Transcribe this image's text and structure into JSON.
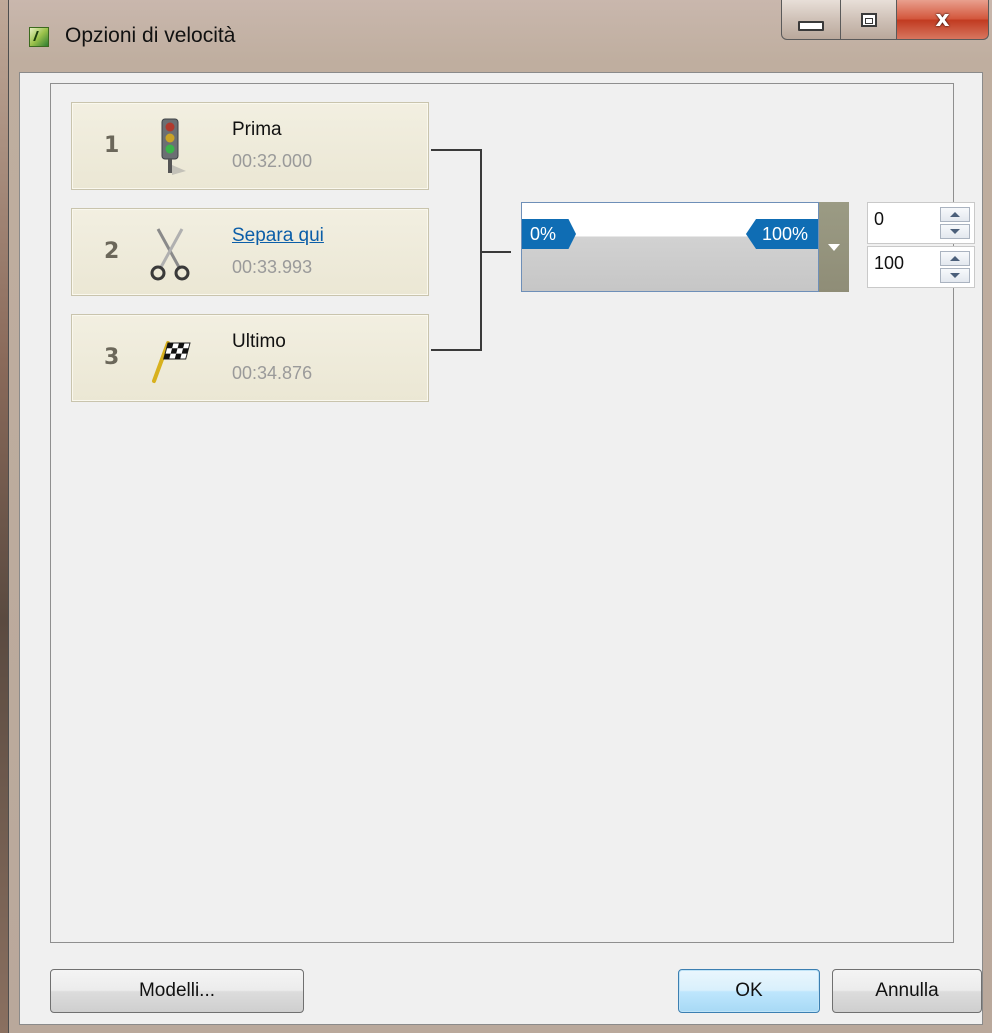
{
  "window": {
    "title": "Opzioni di velocità",
    "controls": {
      "minimize": "minimize",
      "maximize": "maximize",
      "close": "x"
    }
  },
  "segments": [
    {
      "number": "1",
      "name": "Prima",
      "time": "00:32.000",
      "icon": "traffic-light-icon",
      "is_link": false
    },
    {
      "number": "2",
      "name": "Separa qui",
      "time": "00:33.993",
      "icon": "scissors-icon",
      "is_link": true
    },
    {
      "number": "3",
      "name": "Ultimo",
      "time": "00:34.876",
      "icon": "checkered-flag-icon",
      "is_link": false
    }
  ],
  "speed": {
    "start_label": "0%",
    "end_label": "100%",
    "start_value": "0",
    "end_value": "100"
  },
  "buttons": {
    "templates": "Modelli...",
    "ok": "OK",
    "cancel": "Annulla"
  },
  "colors": {
    "accent": "#0f6db4",
    "link": "#0b5ea8",
    "segment_bg": "#ebe7d4",
    "close_button": "#c13b21"
  }
}
